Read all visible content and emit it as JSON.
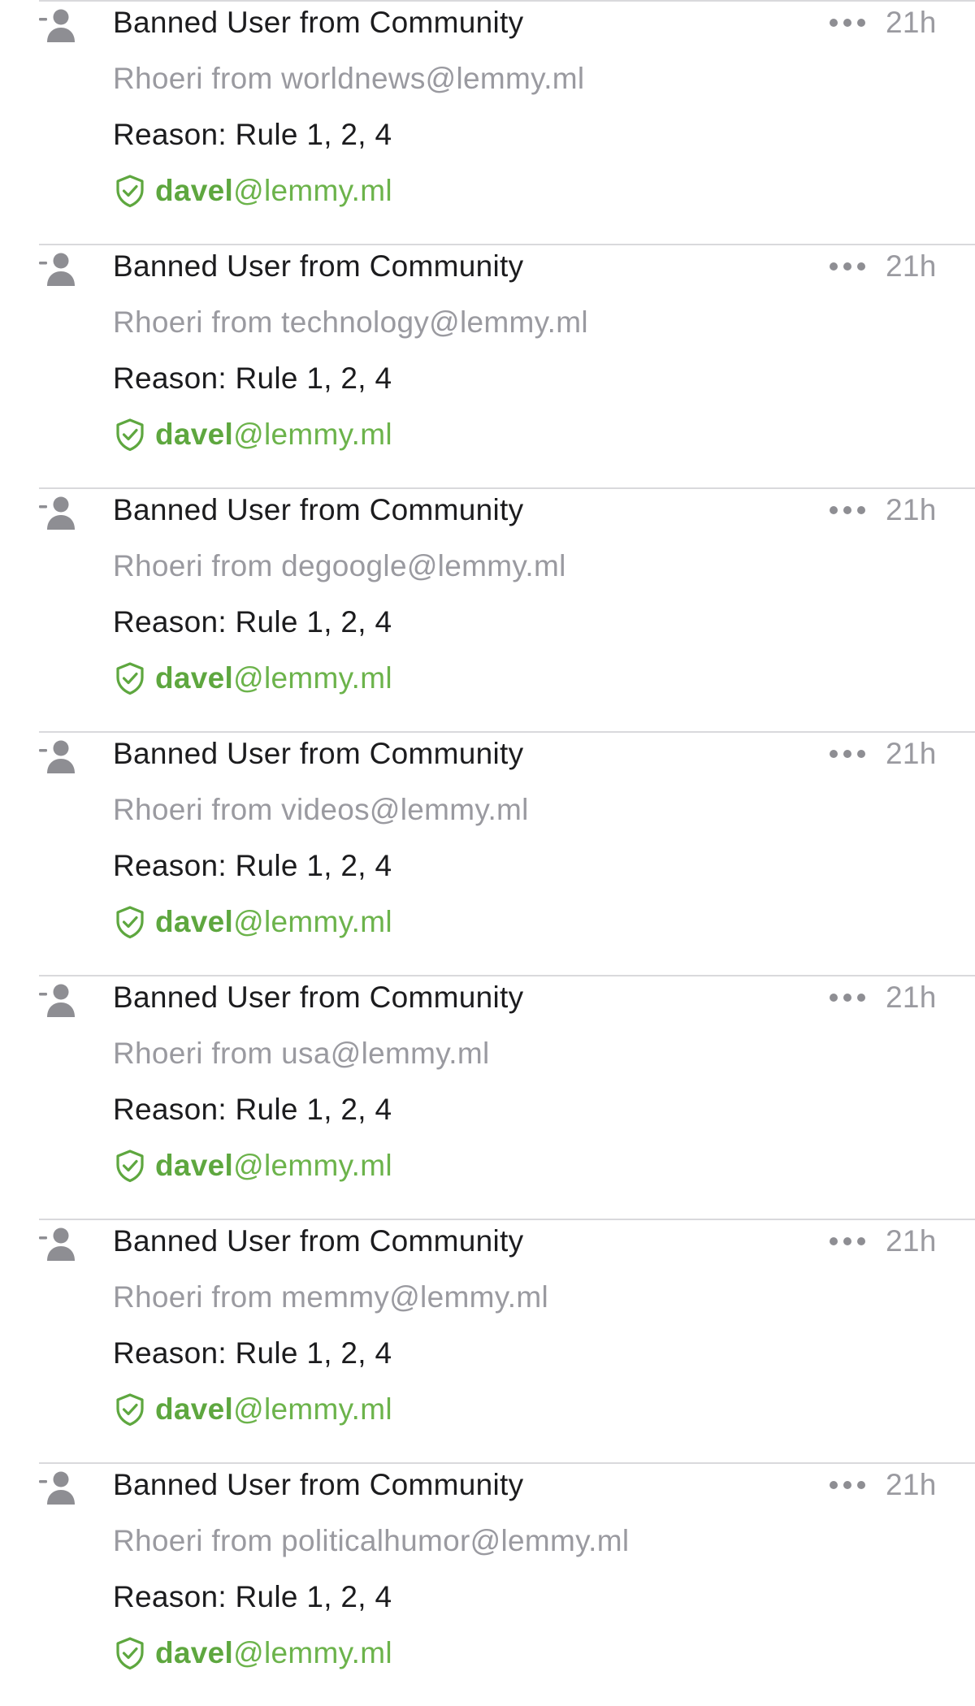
{
  "feed": {
    "entries": [
      {
        "title": "Banned User from Community",
        "meta": "Rhoeri from worldnews@lemmy.ml",
        "reason": "Reason: Rule 1, 2, 4",
        "moderator_name": "davel",
        "moderator_domain": "@lemmy.ml",
        "time": "21h"
      },
      {
        "title": "Banned User from Community",
        "meta": "Rhoeri from technology@lemmy.ml",
        "reason": "Reason: Rule 1, 2, 4",
        "moderator_name": "davel",
        "moderator_domain": "@lemmy.ml",
        "time": "21h"
      },
      {
        "title": "Banned User from Community",
        "meta": "Rhoeri from degoogle@lemmy.ml",
        "reason": "Reason: Rule 1, 2, 4",
        "moderator_name": "davel",
        "moderator_domain": "@lemmy.ml",
        "time": "21h"
      },
      {
        "title": "Banned User from Community",
        "meta": "Rhoeri from videos@lemmy.ml",
        "reason": "Reason: Rule 1, 2, 4",
        "moderator_name": "davel",
        "moderator_domain": "@lemmy.ml",
        "time": "21h"
      },
      {
        "title": "Banned User from Community",
        "meta": "Rhoeri from usa@lemmy.ml",
        "reason": "Reason: Rule 1, 2, 4",
        "moderator_name": "davel",
        "moderator_domain": "@lemmy.ml",
        "time": "21h"
      },
      {
        "title": "Banned User from Community",
        "meta": "Rhoeri from memmy@lemmy.ml",
        "reason": "Reason: Rule 1, 2, 4",
        "moderator_name": "davel",
        "moderator_domain": "@lemmy.ml",
        "time": "21h"
      },
      {
        "title": "Banned User from Community",
        "meta": "Rhoeri from politicalhumor@lemmy.ml",
        "reason": "Reason: Rule 1, 2, 4",
        "moderator_name": "davel",
        "moderator_domain": "@lemmy.ml",
        "time": "21h"
      }
    ]
  },
  "icons": {
    "entry_icon": "person-remove-icon",
    "moderator_icon": "shield-check-icon",
    "menu_icon": "ellipsis-icon"
  },
  "colors": {
    "primary_text": "#1c1c1e",
    "secondary_text": "#9a9aa0",
    "moderator_green": "#5ea73f",
    "divider": "#d9d9dc"
  }
}
